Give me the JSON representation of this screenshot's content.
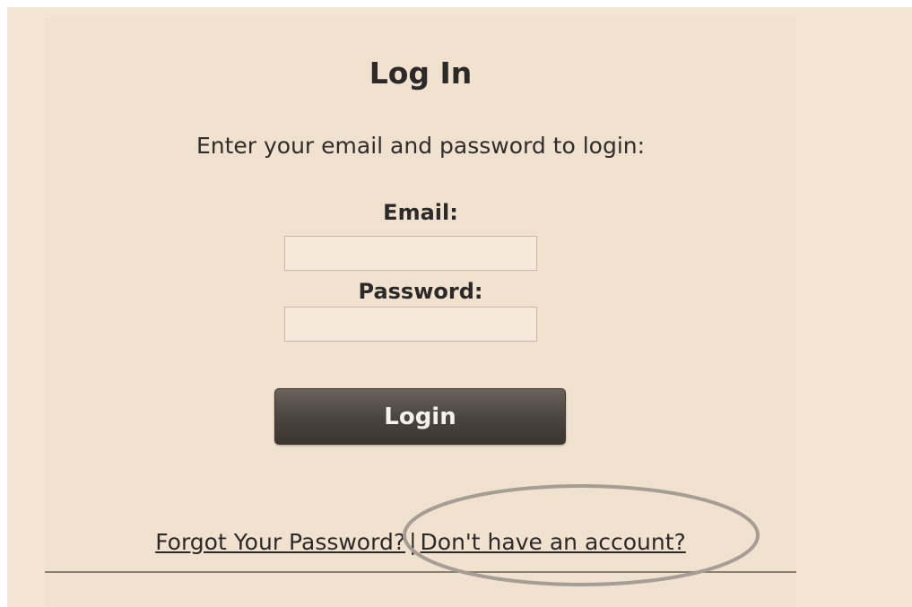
{
  "login": {
    "title": "Log In",
    "subtitle": "Enter your email and password to login:",
    "email_label": "Email:",
    "email_value": "",
    "password_label": "Password:",
    "password_value": "",
    "login_button": "Login",
    "forgot_link": "Forgot Your Password?",
    "separator": "|",
    "signup_link": "Don't have an account?"
  },
  "colors": {
    "background": "#f4e4d2",
    "panel": "#f1e1cf",
    "button": "#4a433d",
    "annotation_circle": "#a69d95"
  }
}
